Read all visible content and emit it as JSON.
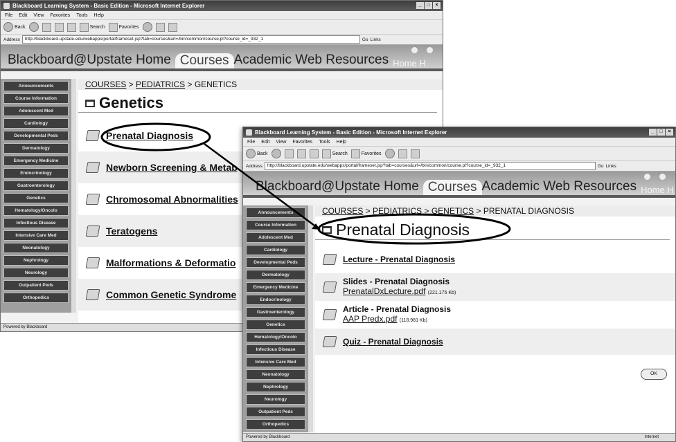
{
  "window_title": "Blackboard Learning System - Basic Edition - Microsoft Internet Explorer",
  "menu": [
    "File",
    "Edit",
    "View",
    "Favorites",
    "Tools",
    "Help"
  ],
  "toolbar": {
    "back": "Back",
    "search": "Search",
    "favorites": "Favorites"
  },
  "address": {
    "label": "Address",
    "url": "http://blackboard.upstate.edu/webapps/portal/frameset.jsp?tab=courses&url=/bin/common/course.pl?course_id=_932_1",
    "go": "Go",
    "links": "Links"
  },
  "header": {
    "home_tab": "Blackboard@Upstate Home",
    "courses_tab": "Courses",
    "resources_tab": "Academic Web Resources",
    "home_short_1": "Home H",
    "home_short_2": "Home H"
  },
  "sidebar_items": [
    "Announcements",
    "Course Information",
    "Adolescent Med",
    "Cardiology",
    "Developmental Peds",
    "Dermatology",
    "Emergency Medicine",
    "Endocrinology",
    "Gastroenterology",
    "Genetics",
    "Hematology/Oncolo",
    "Infectious Disease",
    "Intensive Care Med",
    "Neonatology",
    "Nephrology",
    "Neurology",
    "Outpatient Peds",
    "Orthopedics"
  ],
  "status_text": "Powered by Blackboard",
  "status_zone": "Internet",
  "genetics": {
    "crumb": {
      "c1": "COURSES",
      "sep": " > ",
      "c2": "PEDIATRICS",
      "c3": "GENETICS"
    },
    "title": "Genetics",
    "items": [
      "Prenatal Diagnosis",
      "Newborn Screening & Metab",
      "Chromosomal Abnormalities",
      "Teratogens",
      "Malformations & Deformatio",
      "Common Genetic Syndrome"
    ]
  },
  "prenatal": {
    "crumb": {
      "c1": "COURSES",
      "c2": "PEDIATRICS",
      "c3": "GENETICS",
      "c4": " > PRENATAL DIAGNOSIS"
    },
    "title": "Prenatal Diagnosis",
    "lecture": "Lecture - Prenatal Diagnosis",
    "slides": {
      "title": "Slides - Prenatal Diagnosis",
      "file": "PrenatalDxLecture.pdf",
      "size": "(221.175 Kb)"
    },
    "article": {
      "title": "Article - Prenatal Diagnosis",
      "file": "AAP Predx.pdf",
      "size": "(118.981 Kb)"
    },
    "quiz": "Quiz - Prenatal Diagnosis",
    "ok": "OK"
  }
}
